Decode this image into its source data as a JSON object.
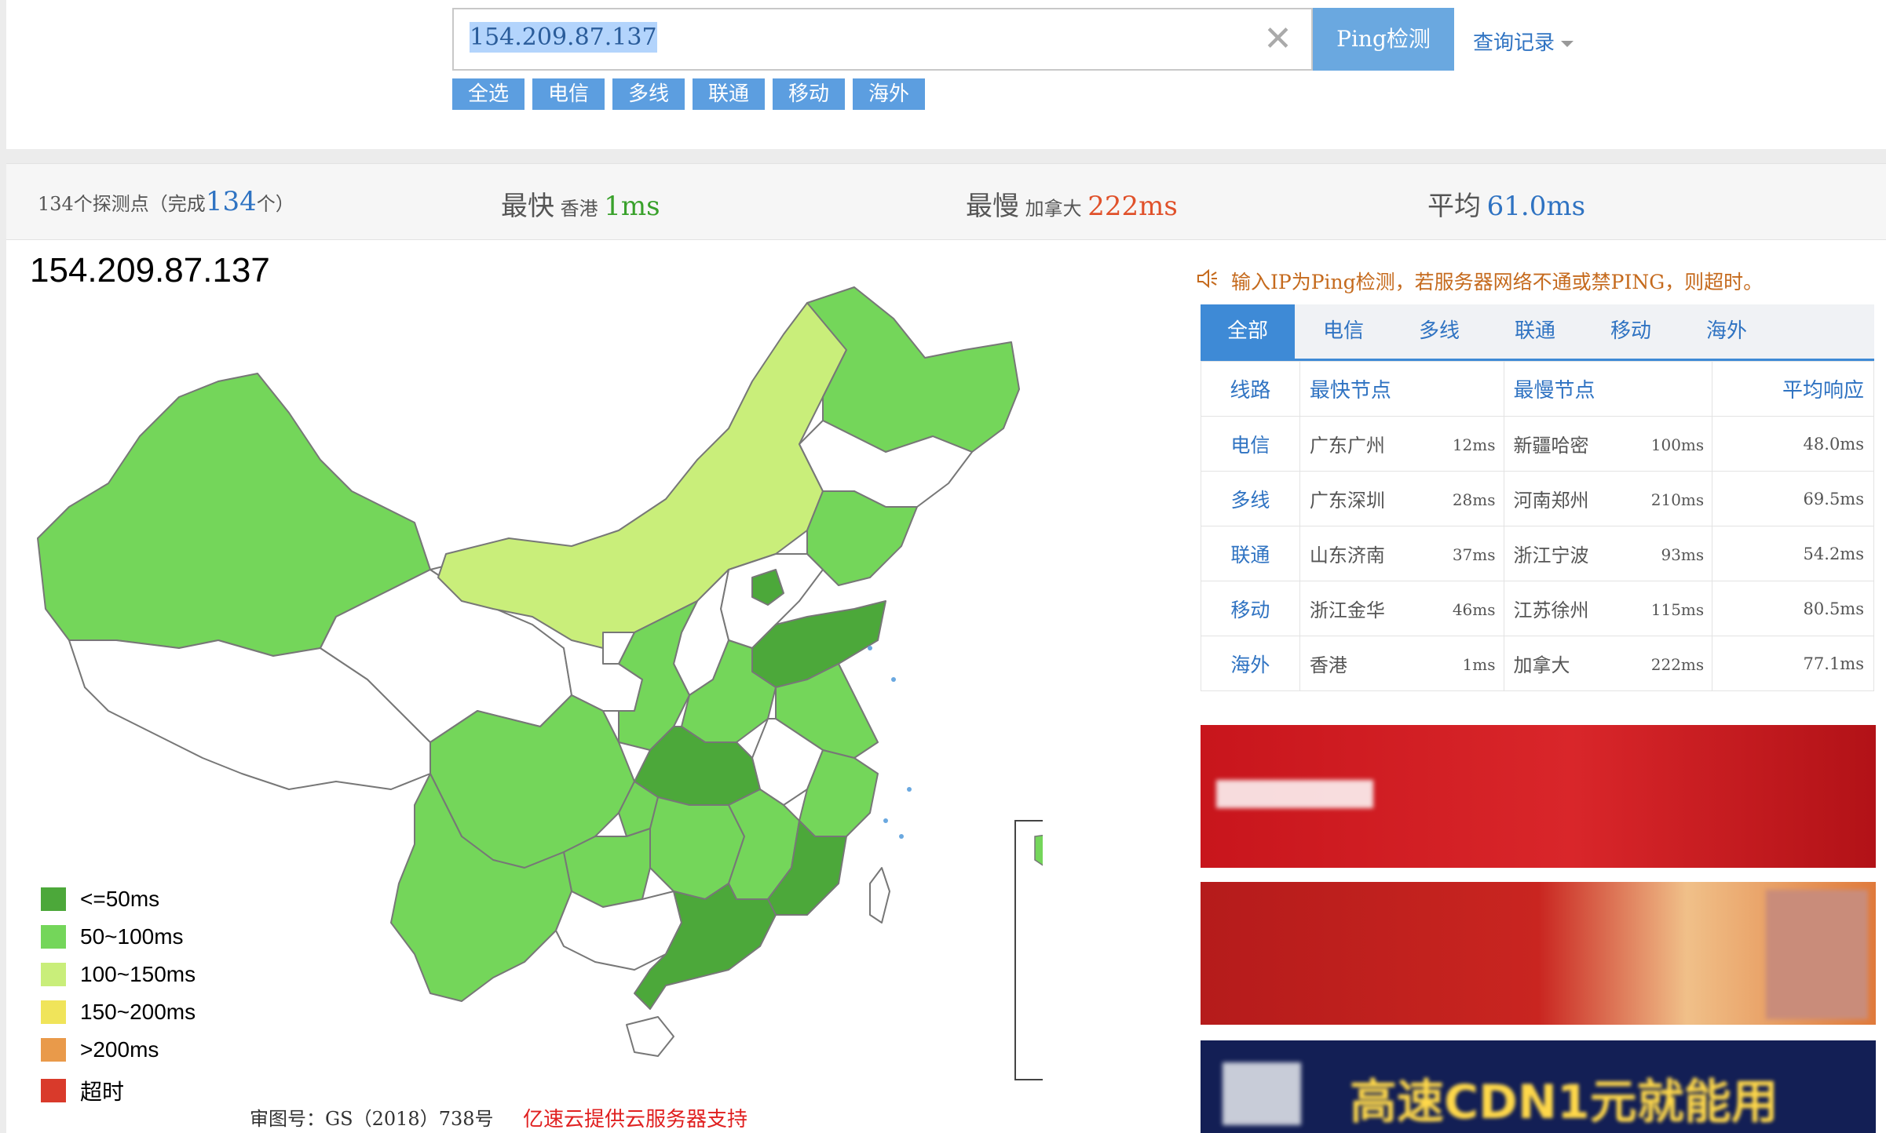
{
  "search": {
    "value": "154.209.87.137",
    "clear_icon": "close-icon",
    "ping_label": "Ping检测",
    "history_label": "查询记录"
  },
  "filters": [
    "全选",
    "电信",
    "多线",
    "联通",
    "移动",
    "海外"
  ],
  "stats": {
    "count_prefix": "134个探测点（完成",
    "count_done": "134",
    "count_suffix": "个）",
    "fastest_label": "最快",
    "fastest_node": "香港",
    "fastest_value": "1ms",
    "slowest_label": "最慢",
    "slowest_node": "加拿大",
    "slowest_value": "222ms",
    "average_label": "平均",
    "average_value": "61.0ms"
  },
  "map": {
    "title": "154.209.87.137",
    "legend": [
      {
        "label": "<=50ms",
        "color": "#4ca83a"
      },
      {
        "label": "50~100ms",
        "color": "#74d65a"
      },
      {
        "label": "100~150ms",
        "color": "#c9ee7a"
      },
      {
        "label": "150~200ms",
        "color": "#f0e45a"
      },
      {
        "label": ">200ms",
        "color": "#e99a4a"
      },
      {
        "label": "超时",
        "color": "#d93a2b"
      }
    ],
    "approval": "审图号：GS（2018）738号",
    "sponsor": "亿速云提供云服务器支持"
  },
  "notice": "输入IP为Ping检测，若服务器网络不通或禁PING，则超时。",
  "tabs": [
    "全部",
    "电信",
    "多线",
    "联通",
    "移动",
    "海外"
  ],
  "table": {
    "headers": [
      "线路",
      "最快节点",
      "最慢节点",
      "平均响应"
    ],
    "rows": [
      {
        "line": "电信",
        "fast": "广东广州",
        "fast_ms": "12ms",
        "slow": "新疆哈密",
        "slow_ms": "100ms",
        "avg": "48.0ms"
      },
      {
        "line": "多线",
        "fast": "广东深圳",
        "fast_ms": "28ms",
        "slow": "河南郑州",
        "slow_ms": "210ms",
        "avg": "69.5ms"
      },
      {
        "line": "联通",
        "fast": "山东济南",
        "fast_ms": "37ms",
        "slow": "浙江宁波",
        "slow_ms": "93ms",
        "avg": "54.2ms"
      },
      {
        "line": "移动",
        "fast": "浙江金华",
        "fast_ms": "46ms",
        "slow": "江苏徐州",
        "slow_ms": "115ms",
        "avg": "80.5ms"
      },
      {
        "line": "海外",
        "fast": "香港",
        "fast_ms": "1ms",
        "slow": "加拿大",
        "slow_ms": "222ms",
        "avg": "77.1ms"
      }
    ]
  },
  "ads": {
    "ad1_line1": "",
    "ad1_line2": "",
    "ad2_line1": "",
    "ad2_line2": "",
    "ad3_line1": "高速CDN1元就能用"
  }
}
